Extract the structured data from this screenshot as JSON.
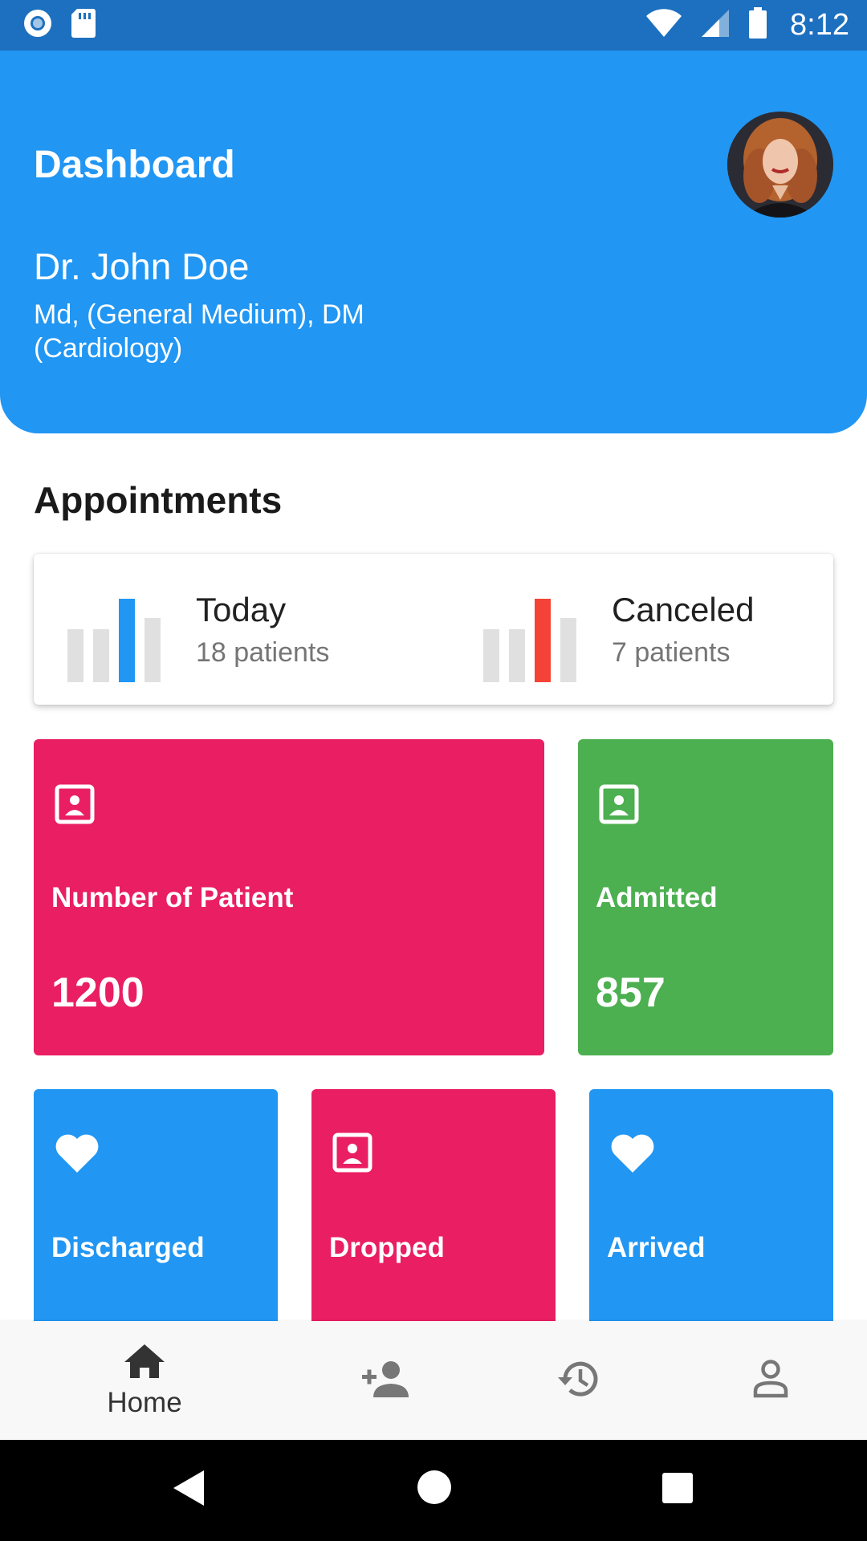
{
  "status_bar": {
    "time": "8:12",
    "left_icons": [
      "record-icon",
      "sd-card-icon"
    ],
    "right_icons": [
      "wifi-icon",
      "cell-signal-icon",
      "battery-icon"
    ]
  },
  "header": {
    "title": "Dashboard",
    "doctor_name": "Dr. John Doe",
    "credentials": "Md, (General Medium), DM (Cardiology)",
    "background_color": "#2196f3"
  },
  "appointments": {
    "title": "Appointments",
    "items": [
      {
        "label": "Today",
        "count": "18 patients",
        "accent_color": "#2196f3",
        "chart_icon": "bar-chart-icon"
      },
      {
        "label": "Canceled",
        "count": "7 patients",
        "accent_color": "#f44336",
        "chart_icon": "bar-chart-icon"
      }
    ]
  },
  "stats": [
    {
      "label": "Number of Patient",
      "value": "1200",
      "icon": "contact-card-icon",
      "color": "#e91e63"
    },
    {
      "label": "Admitted",
      "value": "857",
      "icon": "contact-card-icon",
      "color": "#4caf50"
    },
    {
      "label": "Discharged",
      "icon": "heart-icon",
      "color": "#2196f3"
    },
    {
      "label": "Dropped",
      "icon": "contact-card-icon",
      "color": "#e91e63"
    },
    {
      "label": "Arrived",
      "icon": "heart-icon",
      "color": "#2196f3"
    }
  ],
  "bottom_nav": {
    "items": [
      {
        "label": "Home",
        "icon": "home-icon",
        "active": true
      },
      {
        "label": "",
        "icon": "person-add-icon"
      },
      {
        "label": "",
        "icon": "history-icon"
      },
      {
        "label": "",
        "icon": "person-icon"
      }
    ]
  },
  "system_nav": [
    "back-icon",
    "home-circle-icon",
    "recents-icon"
  ]
}
